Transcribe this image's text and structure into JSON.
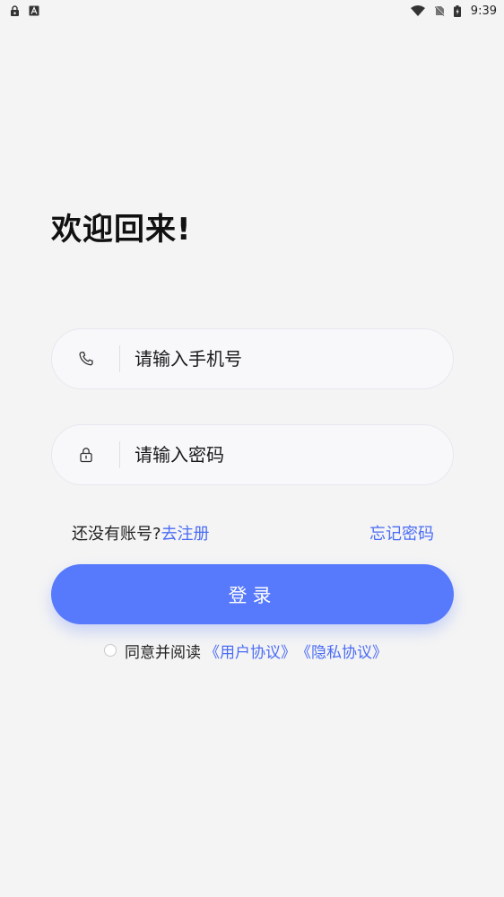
{
  "status_bar": {
    "time": "9:39",
    "left_icons": [
      "lock-icon",
      "font-a-icon"
    ],
    "right_icons": [
      "wifi-icon",
      "no-sim-icon",
      "battery-icon"
    ]
  },
  "title": "欢迎回来!",
  "phone_input": {
    "placeholder": "请输入手机号",
    "value": "",
    "icon": "phone-icon"
  },
  "password_input": {
    "placeholder": "请输入密码",
    "value": "",
    "icon": "lock-icon"
  },
  "register": {
    "prompt": "还没有账号?",
    "link": "去注册"
  },
  "forgot_password": "忘记密码",
  "login_button": "登录",
  "agreement": {
    "checked": false,
    "prefix": "同意并阅读",
    "user_agreement": "《用户协议》",
    "privacy_policy": "《隐私协议》"
  },
  "colors": {
    "accent": "#5779fb",
    "link": "#4a6cf5",
    "background": "#f4f4f4"
  }
}
